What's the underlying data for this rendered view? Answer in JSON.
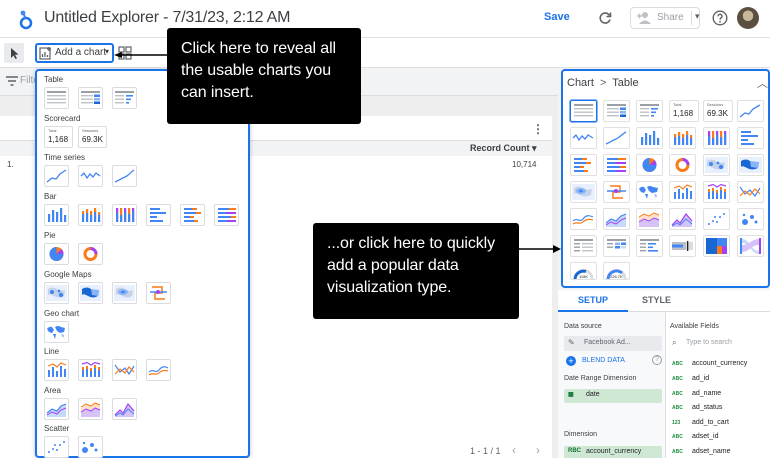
{
  "app": {
    "title": "Untitled Explorer - 7/31/23, 2:12 AM"
  },
  "header": {
    "save_label": "Save",
    "share_label": "Share",
    "icons": [
      "refresh-icon",
      "add-person-icon",
      "help-icon",
      "avatar"
    ]
  },
  "toolbar": {
    "add_chart_label": "Add a chart",
    "icons": [
      "select-arrow-icon",
      "add-chart-icon",
      "add-controls-icon"
    ]
  },
  "filter_bar": {
    "text": "Filte"
  },
  "report_table": {
    "column_header": "Record Count",
    "rows": [
      {
        "num": "1.",
        "value": "10,714"
      }
    ],
    "pagination": "1 - 1 / 1",
    "prev": "‹",
    "next": "›"
  },
  "chart_menu": {
    "sections": [
      {
        "label": "Table",
        "icons": [
          "table-icon",
          "table-heatmap-icon",
          "table-bars-icon"
        ]
      },
      {
        "label": "Scorecard",
        "icons": [
          "scorecard-total-icon",
          "scorecard-sessions-icon"
        ]
      },
      {
        "label": "Time series",
        "icons": [
          "time-series-icon",
          "sparkline-icon",
          "smoothed-time-series-icon"
        ]
      },
      {
        "label": "Bar",
        "icons": [
          "column-chart-icon",
          "stacked-column-icon",
          "100-stacked-column-icon",
          "bar-chart-icon",
          "stacked-bar-icon",
          "100-stacked-bar-icon"
        ]
      },
      {
        "label": "Pie",
        "icons": [
          "pie-chart-icon",
          "donut-chart-icon"
        ]
      },
      {
        "label": "Google Maps",
        "icons": [
          "bubble-map-icon",
          "filled-map-icon",
          "heatmap-map-icon",
          "line-map-icon"
        ]
      },
      {
        "label": "Geo chart",
        "icons": [
          "geo-chart-icon"
        ]
      },
      {
        "label": "Line",
        "icons": [
          "combo-chart-icon",
          "stacked-combo-icon",
          "line-chart-icon",
          "smoothed-line-icon"
        ]
      },
      {
        "label": "Area",
        "icons": [
          "area-chart-icon",
          "stacked-area-icon",
          "100-stacked-area-icon"
        ]
      },
      {
        "label": "Scatter",
        "icons": [
          "scatter-chart-icon",
          "bubble-chart-icon"
        ]
      }
    ],
    "scorecard_total_label": "Total",
    "scorecard_total_value": "1,168",
    "scorecard_sessions_label": "Sessions",
    "scorecard_sessions_value": "69.3K"
  },
  "callouts": {
    "add_chart": "Click here to reveal all the usable charts you can insert.",
    "picker": "...or click here to quickly add a popular data visualization type."
  },
  "chart_picker": {
    "breadcrumb_root": "Chart",
    "breadcrumb_sep": ">",
    "breadcrumb_leaf": "Table",
    "scorecard_total_label": "Total",
    "scorecard_total_value": "1,168",
    "scorecard_sessions_label": "Sessions",
    "scorecard_sessions_value": "69.3K",
    "gauge_value_1": "115K",
    "gauge_value_2": "226.7K"
  },
  "panel_tabs": {
    "setup": "SETUP",
    "style": "STYLE"
  },
  "setup": {
    "data_source_label": "Data source",
    "data_source_value": "Facebook Ad...",
    "blend_label": "BLEND DATA",
    "date_range_label": "Date Range Dimension",
    "date_range_value": "date",
    "dimension_label": "Dimension",
    "dimension_value": "account_currency"
  },
  "available_fields": {
    "label": "Available Fields",
    "search_placeholder": "Type to search",
    "fields": [
      {
        "type": "ABC",
        "name": "account_currency"
      },
      {
        "type": "ABC",
        "name": "ad_id"
      },
      {
        "type": "ABC",
        "name": "ad_name"
      },
      {
        "type": "ABC",
        "name": "ad_status"
      },
      {
        "type": "123",
        "name": "add_to_cart"
      },
      {
        "type": "ABC",
        "name": "adset_id"
      },
      {
        "type": "ABC",
        "name": "adset_name"
      }
    ]
  },
  "colors": {
    "accent": "#1a73e8",
    "chart_blue": "#4285f4",
    "chart_orange": "#fa7b17",
    "chart_purple": "#a142f4",
    "chart_grey": "#bdc1c6",
    "callout_bg": "#000000",
    "dimension_chip": "#cfe8d4"
  }
}
